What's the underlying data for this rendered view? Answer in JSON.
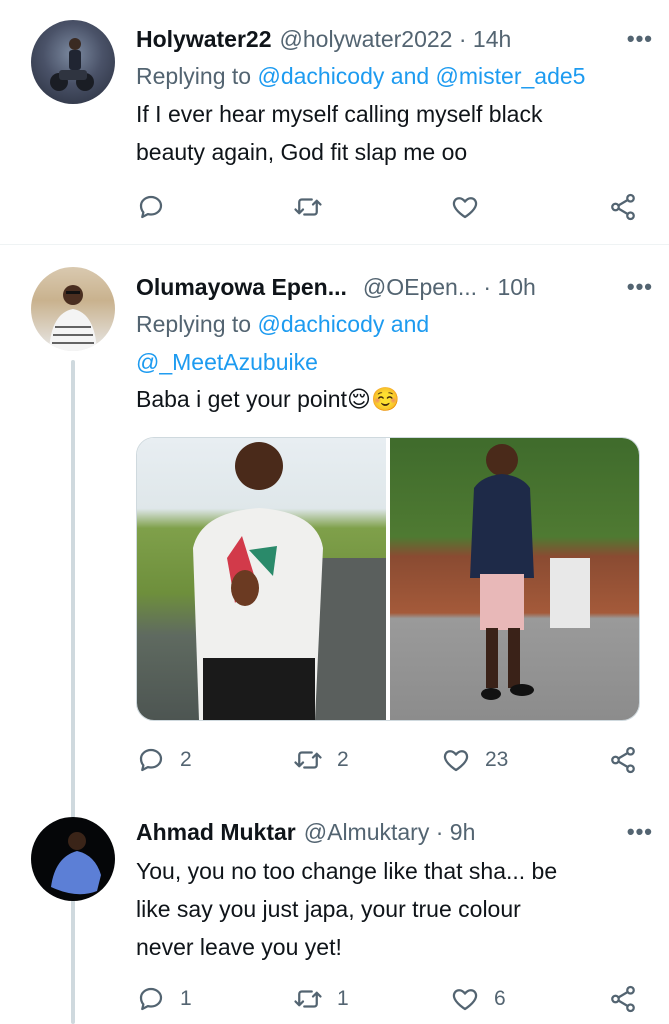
{
  "tweets": [
    {
      "name": "Holywater22",
      "handle": "@holywater2022 · 14h",
      "replying_prefix": "Replying to",
      "replying_to": [
        "@dachicody",
        "@mister_ade5"
      ],
      "replying_joiner": "and",
      "text": [
        "If I ever hear myself calling myself black",
        "beauty again, God fit slap me oo"
      ],
      "reply_count": "",
      "retweet_count": "",
      "like_count": ""
    },
    {
      "name": "Olumayowa Epen...",
      "handle": "@OEpen... · 10h",
      "replying_prefix": "Replying to",
      "replying_to": [
        "@dachicody",
        "@_MeetAzubuike"
      ],
      "replying_joiner": "and",
      "text": [
        "Baba i get your point😌☺️"
      ],
      "reply_count": "2",
      "retweet_count": "2",
      "like_count": "23"
    },
    {
      "name": "Ahmad Muktar",
      "handle": "@Almuktary · 9h",
      "text": [
        "You, you no too change like that sha... be",
        "like say you just japa, your true colour",
        "never leave you yet!"
      ],
      "reply_count": "1",
      "retweet_count": "1",
      "like_count": "6"
    }
  ],
  "more_label": "•••",
  "colors": {
    "link": "#1d9bf0",
    "secondary": "#536471",
    "text": "#0f1419"
  }
}
